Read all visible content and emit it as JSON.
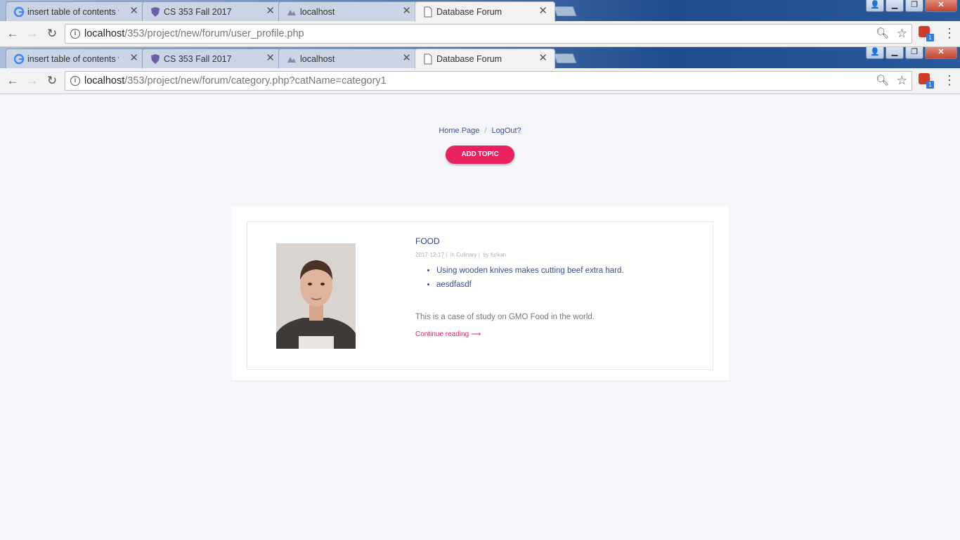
{
  "browser_back": {
    "tabs": [
      {
        "title": "insert table of contents w",
        "favicon": "google-icon"
      },
      {
        "title": "CS 353 Fall 2017",
        "favicon": "shield-icon"
      },
      {
        "title": "localhost",
        "favicon": "phpmyadmin-icon"
      },
      {
        "title": "Database Forum",
        "favicon": "page-icon",
        "active": true
      }
    ],
    "url_host": "localhost",
    "url_path": "/353/project/new/forum/user_profile.php"
  },
  "browser_front": {
    "tabs": [
      {
        "title": "insert table of contents w",
        "favicon": "google-icon"
      },
      {
        "title": "CS 353 Fall 2017",
        "favicon": "shield-icon"
      },
      {
        "title": "localhost",
        "favicon": "phpmyadmin-icon"
      },
      {
        "title": "Database Forum",
        "favicon": "page-icon",
        "active": true
      }
    ],
    "url_host": "localhost",
    "url_path": "/353/project/new/forum/category.php?catName=category1"
  },
  "extension_badge": "1",
  "nav": {
    "home": "Home Page",
    "separator": "/",
    "logout": "LogOut?"
  },
  "add_topic_label": "ADD TOPIC",
  "post": {
    "title": "FOOD",
    "date": "2017-12-17",
    "category": "in Culinary",
    "author": "by furkan",
    "items": [
      "Using wooden knives makes cutting beef extra hard.",
      "aesdfasdf"
    ],
    "summary": "This is a case of study on GMO Food in the world.",
    "continue_label": "Continue reading ⟶"
  },
  "colors": {
    "accent": "#e8215f",
    "link": "#3b4d8f",
    "page_bg": "#f5f6f9"
  }
}
